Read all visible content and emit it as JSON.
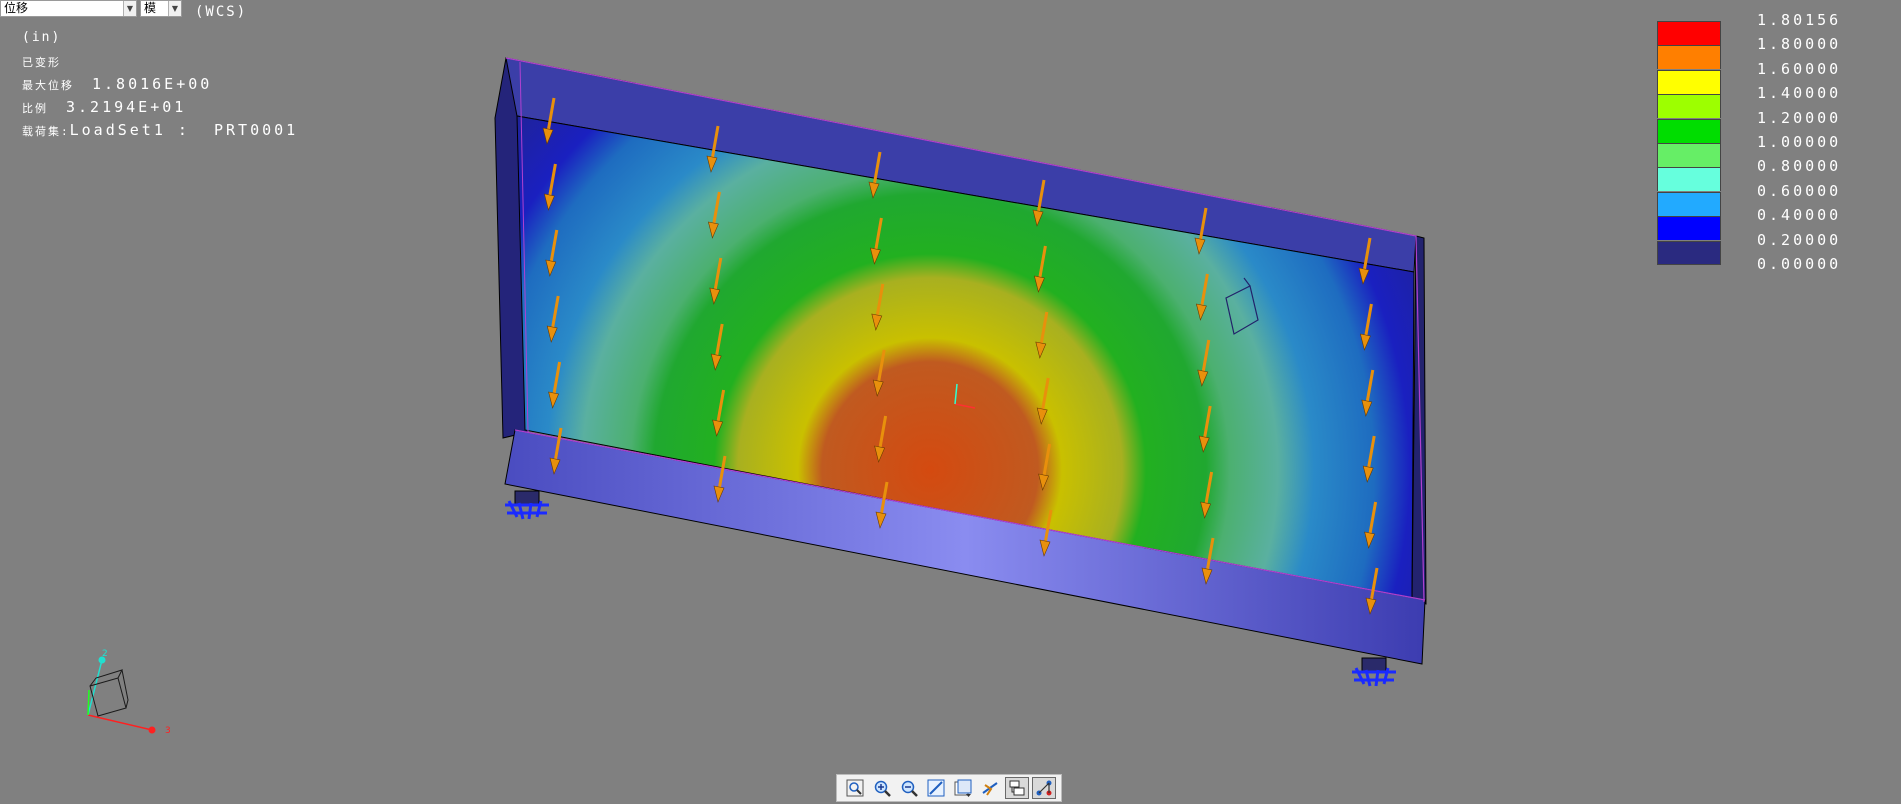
{
  "toolbar_top": {
    "result_select_value": "位移",
    "component_select_value": "模",
    "coord_system": "(WCS)"
  },
  "info": {
    "unit": "(in)",
    "deformed": "已变形",
    "max_disp_label": "最大位移",
    "max_disp_value": "1.8016E+00",
    "scale_label": "比例",
    "scale_value": "3.2194E+01",
    "loadset_label": "载荷集:",
    "loadset_value": "LoadSet1 :  PRT0001"
  },
  "legend": {
    "labels": [
      "1.80156",
      "1.80000",
      "1.60000",
      "1.40000",
      "1.20000",
      "1.00000",
      "0.80000",
      "0.60000",
      "0.40000",
      "0.20000",
      "0.00000"
    ],
    "colors": [
      "#ff0000",
      "#ff7f00",
      "#ffff00",
      "#9dff00",
      "#00dd00",
      "#66ee66",
      "#66ffdd",
      "#22aaff",
      "#0000ff",
      "#2a2a80"
    ]
  },
  "triad": {
    "z": "2",
    "x": "3"
  },
  "view_toolbar": {
    "icons": [
      "refit-icon",
      "zoom-in-icon",
      "zoom-out-icon",
      "repaint-icon",
      "saved-views-icon",
      "spin-center-icon",
      "layers-icon",
      "datum-display-icon"
    ]
  },
  "colors": {
    "background": "#808080",
    "beam": "#4a4fc4",
    "load_arrow": "#e8900c",
    "constraint": "#1a2aff"
  }
}
